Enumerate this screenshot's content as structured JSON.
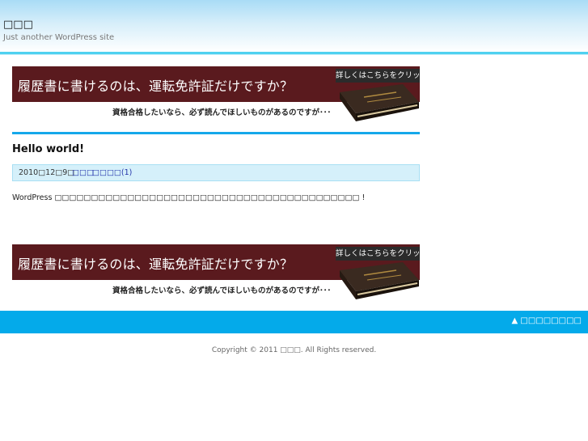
{
  "site": {
    "title": "□□□",
    "tagline": "Just another WordPress site"
  },
  "banner": {
    "headline": "履歴書に書けるのは、運転免許証だけですか？",
    "cta": "詳しくはこちらをクリック",
    "subtext": "資格合格したいなら、必ず読んでほしいものがあるのですが･･･"
  },
  "post": {
    "title": "Hello world!",
    "date": "2010□12□9□",
    "author": "□□□",
    "comments": "□□□□(1)",
    "body": "WordPress □□□□□□□□□□□□□□□□□□□□□□□□□□□□□□□□□□□□□□□□□□ !"
  },
  "footer": {
    "to_top": "▲ □□□□□□□□",
    "copyright": "Copyright © 2011 □□□. All Rights reserved."
  },
  "colors": {
    "accent": "#15a8ea",
    "footer_bar": "#04aaea",
    "banner_dark": "#5a1a1e",
    "meta_bg": "#d5f0fa"
  }
}
